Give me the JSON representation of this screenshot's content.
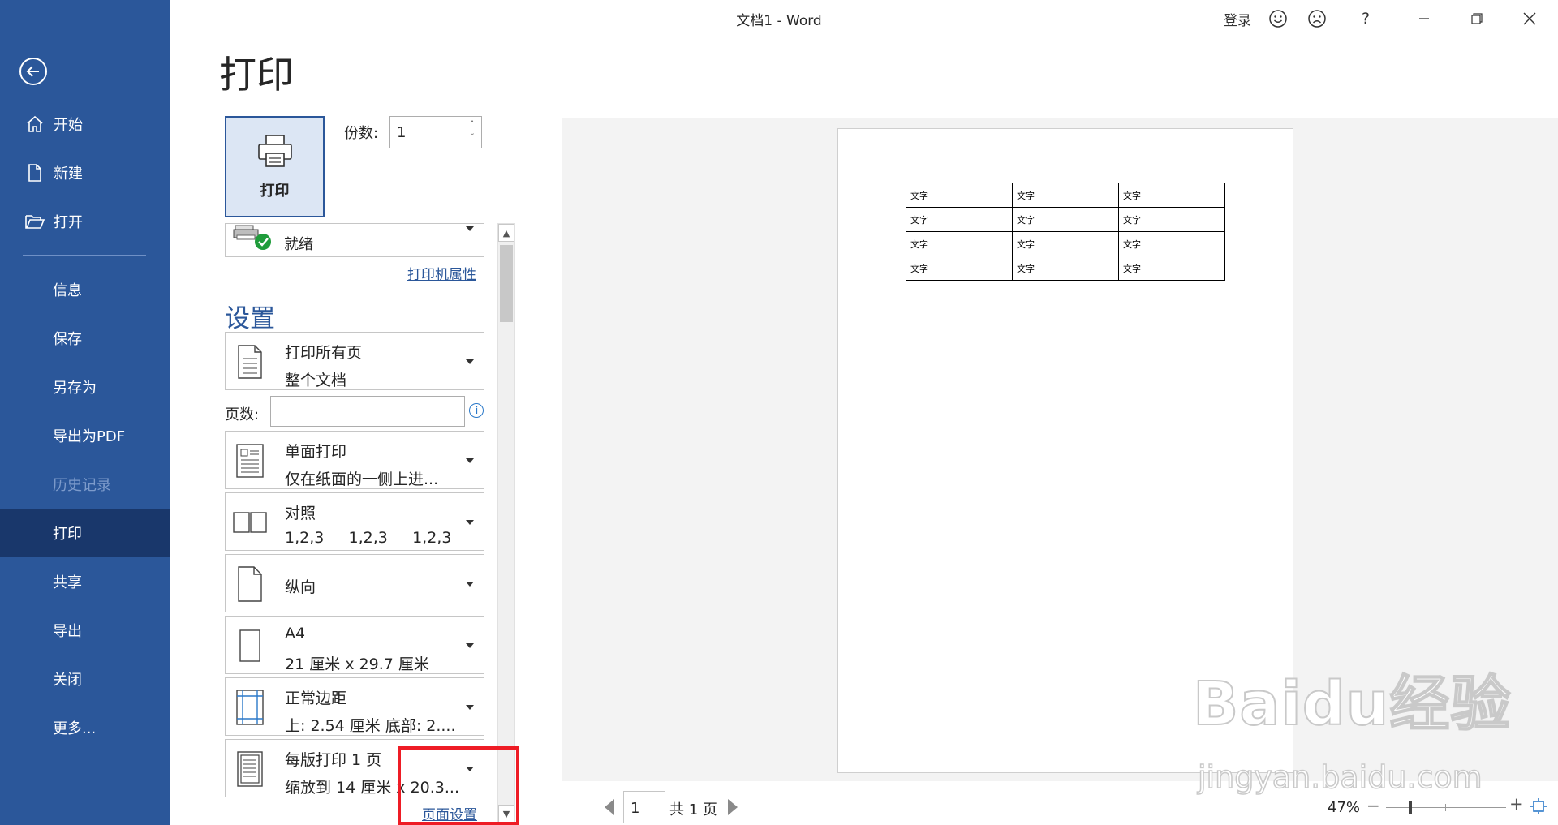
{
  "titlebar": {
    "doc_title": "文档1  -  Word",
    "sign_in": "登录",
    "help": "?",
    "smile_icon": "smile-icon",
    "frown_icon": "frown-icon"
  },
  "nav": {
    "items": [
      {
        "label": "开始",
        "icon": "home-icon"
      },
      {
        "label": "新建",
        "icon": "new-document-icon"
      },
      {
        "label": "打开",
        "icon": "folder-open-icon"
      },
      {
        "label": "信息"
      },
      {
        "label": "保存"
      },
      {
        "label": "另存为"
      },
      {
        "label": "导出为PDF"
      },
      {
        "label": "历史记录"
      },
      {
        "label": "打印"
      },
      {
        "label": "共享"
      },
      {
        "label": "导出"
      },
      {
        "label": "关闭"
      },
      {
        "label": "更多..."
      }
    ],
    "active": "打印",
    "disabled": "历史记录"
  },
  "print": {
    "heading": "打印",
    "button_label": "打印",
    "copies_label": "份数:",
    "copies_value": "1",
    "printer_status": "就绪",
    "printer_properties": "打印机属性",
    "settings_heading": "设置",
    "pages_label": "页数:",
    "pages_value": "",
    "info": "i",
    "options": [
      {
        "line1": "打印所有页",
        "line2": "整个文档"
      },
      {
        "line1": "单面打印",
        "line2": "仅在纸面的一侧上进..."
      },
      {
        "line1": "对照",
        "line2": "1,2,3     1,2,3     1,2,3"
      },
      {
        "line1": "纵向",
        "line2": ""
      },
      {
        "line1": "A4",
        "line2": "21 厘米 x 29.7 厘米"
      },
      {
        "line1": "正常边距",
        "line2": "上: 2.54 厘米 底部: 2...."
      },
      {
        "line1": "每版打印 1 页",
        "line2": "缩放到 14 厘米 x 20.3..."
      }
    ],
    "page_setup_link": "页面设置"
  },
  "preview": {
    "table": [
      [
        "文字",
        "文字",
        "文字"
      ],
      [
        "文字",
        "文字",
        "文字"
      ],
      [
        "文字",
        "文字",
        "文字"
      ],
      [
        "文字",
        "文字",
        "文字"
      ]
    ],
    "page_number": "1",
    "page_total": "共 1 页",
    "zoom": "47%",
    "zoom_minus": "−",
    "zoom_plus": "+",
    "zoom_level": 0.47
  },
  "watermark": {
    "main": "Baidu经验",
    "url": "jingyan.baidu.com"
  },
  "colors": {
    "nav_bg": "#2b579a",
    "nav_active": "#19376b",
    "accent": "#2b579a",
    "highlight_box": "#ee1c25"
  }
}
